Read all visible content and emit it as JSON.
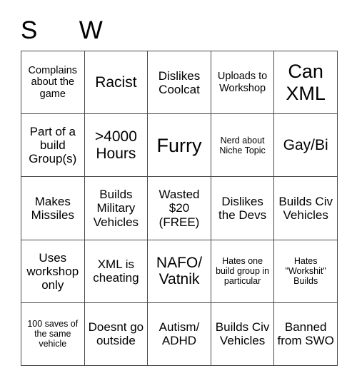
{
  "card": {
    "title": "S      W",
    "columns": 5,
    "rows": 5,
    "border_color": "#4a4a4a",
    "background_color": "#ffffff",
    "text_color": "#000000",
    "cells": [
      {
        "text": "Complains about the game",
        "size": "fs-sm"
      },
      {
        "text": "Racist",
        "size": "fs-lg"
      },
      {
        "text": "Dislikes Coolcat",
        "size": "fs-md"
      },
      {
        "text": "Uploads to Workshop",
        "size": "fs-sm"
      },
      {
        "text": "Can XML",
        "size": "fs-xl"
      },
      {
        "text": "Part of a build Group(s)",
        "size": "fs-md"
      },
      {
        "text": ">4000 Hours",
        "size": "fs-lg"
      },
      {
        "text": "Furry",
        "size": "fs-xl"
      },
      {
        "text": "Nerd about Niche Topic",
        "size": "fs-xs"
      },
      {
        "text": "Gay/Bi",
        "size": "fs-lg"
      },
      {
        "text": "Makes Missiles",
        "size": "fs-md"
      },
      {
        "text": "Builds Military Vehicles",
        "size": "fs-md"
      },
      {
        "text": "Wasted $20 (FREE)",
        "size": "fs-md"
      },
      {
        "text": "Dislikes the Devs",
        "size": "fs-md"
      },
      {
        "text": "Builds Civ Vehicles",
        "size": "fs-md"
      },
      {
        "text": "Uses workshop only",
        "size": "fs-md"
      },
      {
        "text": "XML is cheating",
        "size": "fs-md"
      },
      {
        "text": "NAFO/ Vatnik",
        "size": "fs-lg"
      },
      {
        "text": "Hates one build group in particular",
        "size": "fs-xs"
      },
      {
        "text": "Hates \"Workshit\" Builds",
        "size": "fs-xs"
      },
      {
        "text": "100 saves of the same vehicle",
        "size": "fs-xs"
      },
      {
        "text": "Doesnt go outside",
        "size": "fs-md"
      },
      {
        "text": "Autism/ ADHD",
        "size": "fs-md"
      },
      {
        "text": "Builds Civ Vehicles",
        "size": "fs-md"
      },
      {
        "text": "Banned from SWO",
        "size": "fs-md"
      }
    ]
  }
}
